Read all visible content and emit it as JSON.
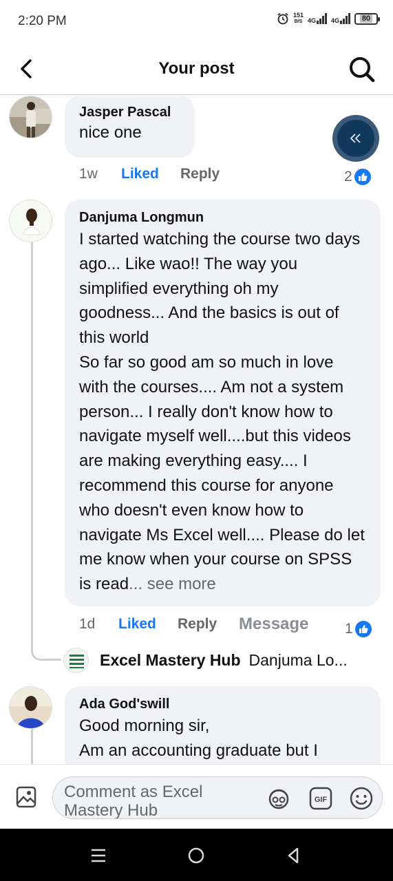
{
  "status_bar": {
    "time": "2:20 PM",
    "net_speed_value": "151",
    "net_speed_unit": "B/S",
    "network_1": "4G",
    "network_2": "4G",
    "battery": "80"
  },
  "header": {
    "title": "Your post",
    "back_icon": "chevron-left-icon",
    "search_icon": "search-icon"
  },
  "comments": [
    {
      "author": "Jasper Pascal",
      "text": "nice one",
      "time": "1w",
      "liked_label": "Liked",
      "reply_label": "Reply",
      "reaction_count": "2"
    },
    {
      "author": "Danjuma Longmun",
      "text": "I started watching the course two days ago... Like wao!! The way you simplified everything oh my goodness... And the basics is out of this world\nSo far so good am so much in love with the courses.... Am not a system person... I really don't know how to navigate myself well....but this videos are making everything easy.... I recommend this course for anyone who doesn't even know how to navigate Ms Excel well.... Please do let me know when your course on SPSS is read",
      "see_more": "... see more",
      "time": "1d",
      "liked_label": "Liked",
      "reply_label": "Reply",
      "message_label": "Message",
      "reaction_count": "1",
      "reply_preview": {
        "page_name": "Excel Mastery Hub",
        "snippet": "Danjuma Lo..."
      }
    },
    {
      "author": "Ada God'swill",
      "text": "Good morning sir,\nAm an accounting graduate but I"
    }
  ],
  "float_button_icon": "double-chevron-left-icon",
  "composer": {
    "placeholder": "Comment as Excel Mastery Hub",
    "icons": [
      "photo-icon",
      "avatar-sticker-icon",
      "gif-icon",
      "emoji-icon"
    ]
  },
  "navbar": {
    "icons": [
      "menu-icon",
      "home-icon",
      "back-icon"
    ]
  },
  "colors": {
    "accent": "#1877f2",
    "bubble": "#f0f2f5",
    "float_button": "#12385c"
  }
}
